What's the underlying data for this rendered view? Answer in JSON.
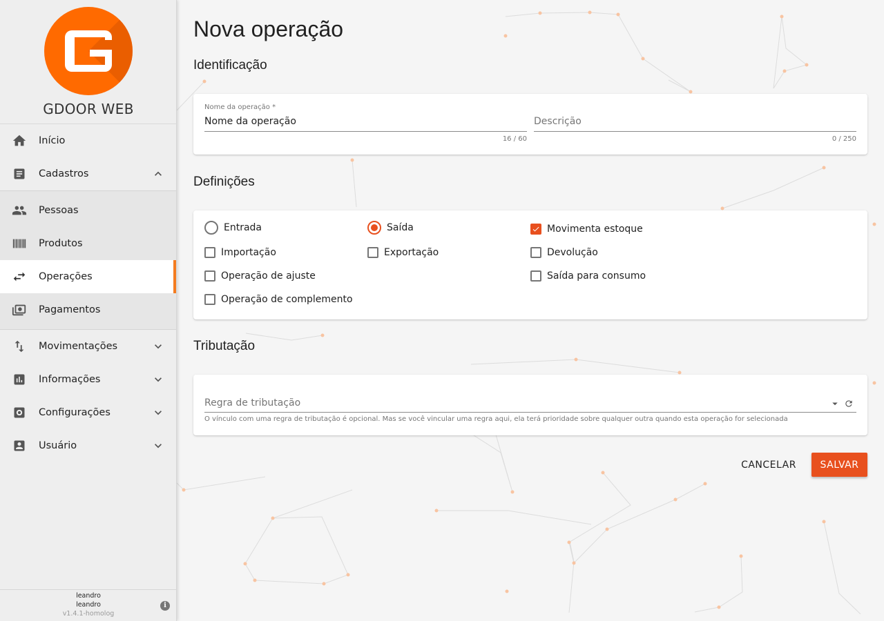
{
  "app": {
    "brand": "GDOOR WEB"
  },
  "sidebar": {
    "items": [
      {
        "label": "Início"
      },
      {
        "label": "Cadastros"
      },
      {
        "label": "Pessoas"
      },
      {
        "label": "Produtos"
      },
      {
        "label": "Operações"
      },
      {
        "label": "Pagamentos"
      },
      {
        "label": "Movimentações"
      },
      {
        "label": "Informações"
      },
      {
        "label": "Configurações"
      },
      {
        "label": "Usuário"
      }
    ],
    "footer": {
      "user_line1": "leandro",
      "user_line2": "leandro",
      "version": "v1.4.1-homolog"
    }
  },
  "page": {
    "title": "Nova operação",
    "identificacao": {
      "title": "Identificação",
      "nome": {
        "label": "Nome da operação *",
        "value": "Nome da operação",
        "counter": "16 / 60"
      },
      "descricao": {
        "placeholder": "Descrição",
        "counter": "0 / 250"
      }
    },
    "definicoes": {
      "title": "Definições",
      "entrada": "Entrada",
      "saida": "Saída",
      "movimenta_estoque": "Movimenta estoque",
      "importacao": "Importação",
      "exportacao": "Exportação",
      "devolucao": "Devolução",
      "ajuste": "Operação de ajuste",
      "consumo": "Saída para consumo",
      "complemento": "Operação de complemento"
    },
    "tributacao": {
      "title": "Tributação",
      "placeholder": "Regra de tributação",
      "hint": "O vínculo com uma regra de tributação é opcional. Mas se você vincular uma regra aqui, ela terá prioridade sobre qualquer outra quando esta operação for selecionada"
    },
    "actions": {
      "cancel": "CANCELAR",
      "save": "SALVAR"
    }
  },
  "state": {
    "tipo": "Saída",
    "movimenta_estoque": true,
    "importacao": false,
    "exportacao": false,
    "devolucao": false,
    "ajuste": false,
    "consumo": false,
    "complemento": false
  },
  "colors": {
    "accent": "#e8501e",
    "brand": "#ff6a00",
    "active_indicator": "#f47c20"
  }
}
